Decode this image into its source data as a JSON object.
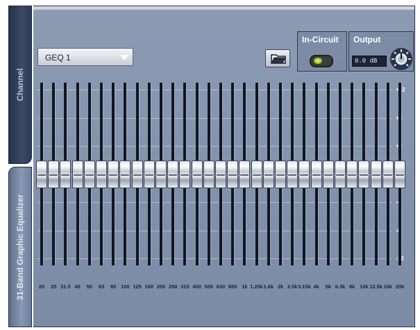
{
  "tabs": {
    "channel": "Channel",
    "plugin": "31-Band Graphic Equalizer"
  },
  "preset": {
    "name": "GEQ 1"
  },
  "in_circuit": {
    "label": "In-Circuit",
    "state": "on",
    "led_color": "#a6d33a"
  },
  "output": {
    "label": "Output",
    "value": "0.0 dB"
  },
  "db_scale": [
    "+12",
    "+8",
    "+4",
    "0",
    "-4",
    "-8",
    "-12"
  ],
  "bands": [
    {
      "freq": "20",
      "gain_db": 0
    },
    {
      "freq": "25",
      "gain_db": 0
    },
    {
      "freq": "31.5",
      "gain_db": 0
    },
    {
      "freq": "40",
      "gain_db": 0
    },
    {
      "freq": "50",
      "gain_db": 0
    },
    {
      "freq": "63",
      "gain_db": 0
    },
    {
      "freq": "80",
      "gain_db": 0
    },
    {
      "freq": "100",
      "gain_db": 0
    },
    {
      "freq": "125",
      "gain_db": 0
    },
    {
      "freq": "160",
      "gain_db": 0
    },
    {
      "freq": "200",
      "gain_db": 0
    },
    {
      "freq": "250",
      "gain_db": 0
    },
    {
      "freq": "315",
      "gain_db": 0
    },
    {
      "freq": "400",
      "gain_db": 0
    },
    {
      "freq": "500",
      "gain_db": 0
    },
    {
      "freq": "630",
      "gain_db": 0
    },
    {
      "freq": "800",
      "gain_db": 0
    },
    {
      "freq": "1k",
      "gain_db": 0
    },
    {
      "freq": "1.25k",
      "gain_db": 0
    },
    {
      "freq": "1.6k",
      "gain_db": 0
    },
    {
      "freq": "2k",
      "gain_db": 0
    },
    {
      "freq": "2.5k",
      "gain_db": 0
    },
    {
      "freq": "3.15k",
      "gain_db": 0
    },
    {
      "freq": "4k",
      "gain_db": 0
    },
    {
      "freq": "5k",
      "gain_db": 0
    },
    {
      "freq": "6.3k",
      "gain_db": 0
    },
    {
      "freq": "8k",
      "gain_db": 0
    },
    {
      "freq": "10k",
      "gain_db": 0
    },
    {
      "freq": "12.5k",
      "gain_db": 0
    },
    {
      "freq": "16k",
      "gain_db": 0
    },
    {
      "freq": "20k",
      "gain_db": 0
    }
  ],
  "colors": {
    "panel": "#8494ad",
    "tab_active": "#7b8aa6",
    "tab_inactive": "#2f3c57"
  }
}
